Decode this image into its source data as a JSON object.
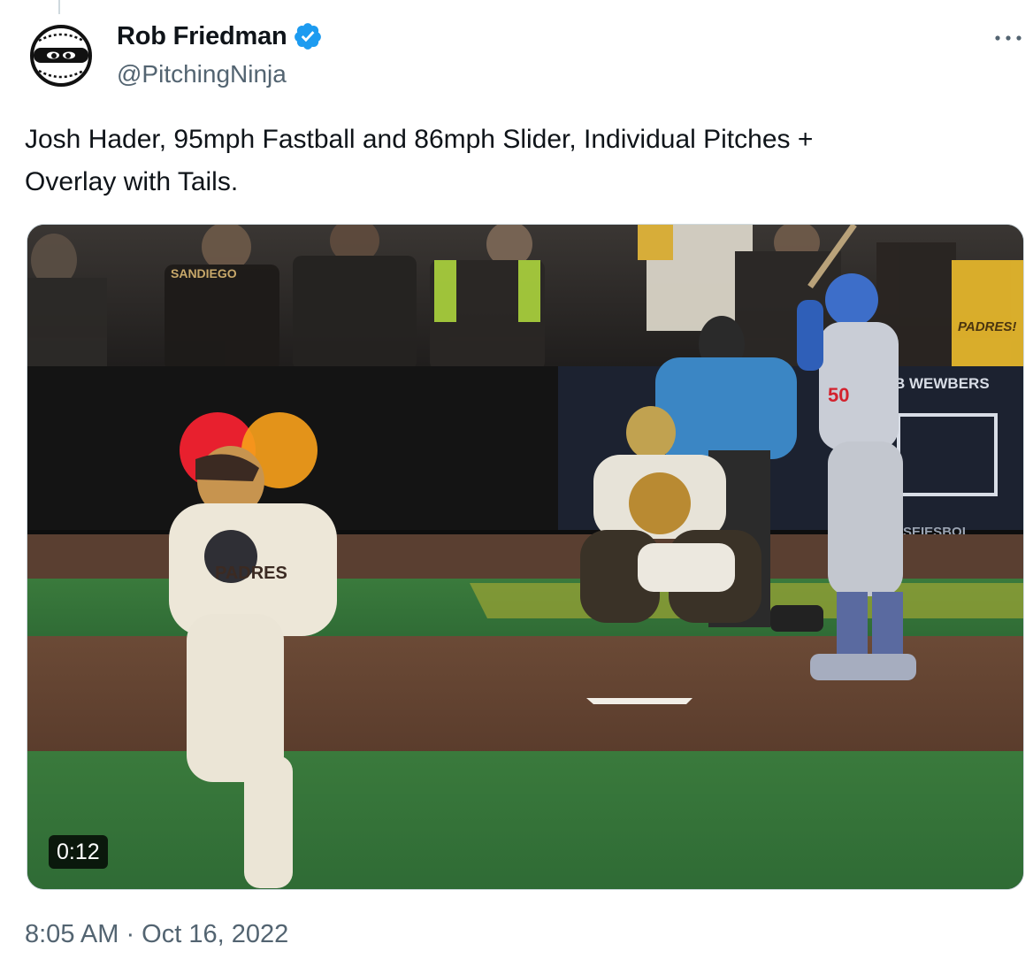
{
  "author": {
    "name": "Rob Friedman",
    "handle": "@PitchingNinja",
    "verified": true,
    "avatar_icon": "ninja-baseball-avatar",
    "verified_icon": "verified-badge-icon",
    "verified_color": "#1d9bf0"
  },
  "menu_icon": "more-options-icon",
  "tweet": {
    "text_line1": "Josh Hader, 95mph Fastball and 86mph Slider, Individual Pitches +",
    "text_line2": "Overlay with Tails.",
    "timestamp": "8:05 AM · Oct 16, 2022"
  },
  "media": {
    "type": "video",
    "duration": "0:12",
    "scene_signage": {
      "wall_top": "B WEWBERS",
      "wall_bottom": "ESEIESBOL",
      "fan_jersey": "SANDIEGO",
      "fan_sign": "PADRES!",
      "batter_number": "50",
      "pitcher_jersey": "PADRES"
    }
  }
}
